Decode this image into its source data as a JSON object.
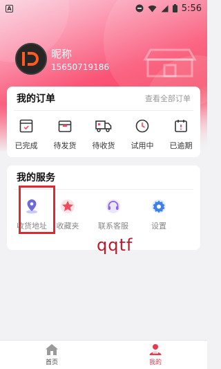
{
  "status_bar": {
    "time": "5:56",
    "notification_icon": "a-icon"
  },
  "profile": {
    "nickname": "昵称",
    "phone": "15650719186"
  },
  "orders": {
    "title": "我的订单",
    "view_all": "查看全部订单",
    "items": [
      {
        "label": "已完成",
        "icon": "completed-box-icon"
      },
      {
        "label": "待发货",
        "icon": "pending-ship-icon"
      },
      {
        "label": "待收货",
        "icon": "delivery-truck-icon"
      },
      {
        "label": "试用中",
        "icon": "clock-icon"
      },
      {
        "label": "已逾期",
        "icon": "overdue-calendar-icon"
      }
    ]
  },
  "services": {
    "title": "我的服务",
    "items": [
      {
        "label": "收货地址",
        "icon": "location-pin-icon"
      },
      {
        "label": "收藏夹",
        "icon": "star-icon"
      },
      {
        "label": "联系客服",
        "icon": "headset-icon"
      },
      {
        "label": "设置",
        "icon": "gear-icon"
      }
    ]
  },
  "watermark": "qqtf",
  "tabbar": {
    "home": "首页",
    "mine": "我的"
  },
  "colors": {
    "accent": "#f6435e",
    "tab_active": "#e83a4e",
    "highlight": "#e2262c"
  }
}
